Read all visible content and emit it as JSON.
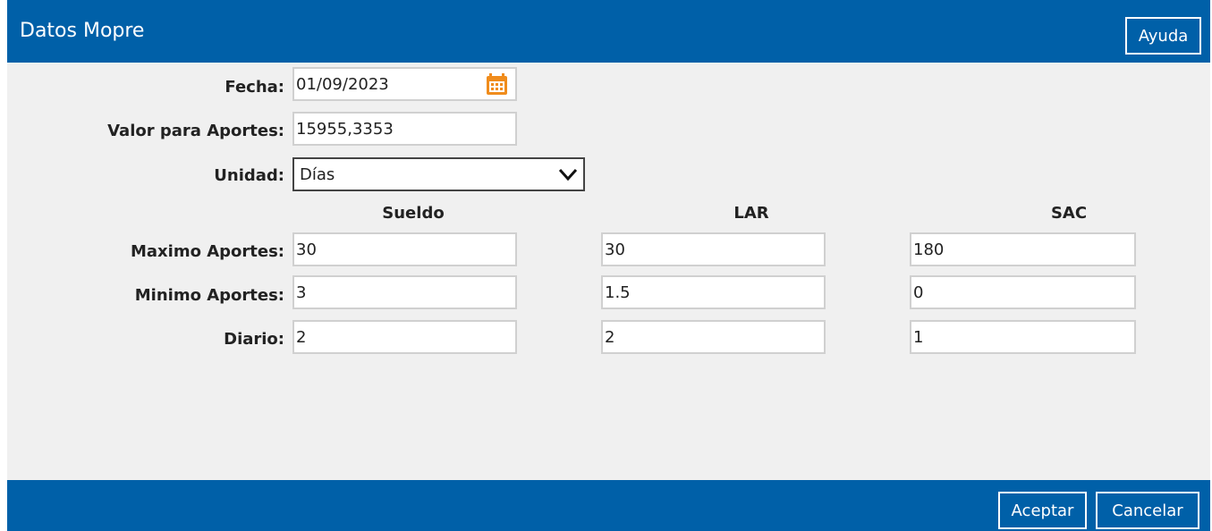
{
  "dialog": {
    "title": "Datos Mopre",
    "help_label": "Ayuda"
  },
  "form": {
    "fecha": {
      "label": "Fecha:",
      "value": "01/09/2023"
    },
    "valor_aportes": {
      "label": "Valor para Aportes:",
      "value": "15955,3353"
    },
    "unidad": {
      "label": "Unidad:",
      "value": "Días"
    }
  },
  "grid": {
    "columns": [
      "Sueldo",
      "LAR",
      "SAC"
    ],
    "rows": [
      {
        "label": "Maximo Aportes:",
        "values": [
          "30",
          "30",
          "180"
        ]
      },
      {
        "label": "Minimo Aportes:",
        "values": [
          "3",
          "1.5",
          "0"
        ]
      },
      {
        "label": "Diario:",
        "values": [
          "2",
          "2",
          "1"
        ]
      }
    ]
  },
  "footer": {
    "ok_label": "Aceptar",
    "cancel_label": "Cancelar"
  },
  "colors": {
    "primary": "#0060a8",
    "background": "#f0f0f0",
    "calendar_icon": "#f08c1c"
  },
  "icons": {
    "calendar": "calendar-icon",
    "dropdown": "chevron-down-icon"
  }
}
